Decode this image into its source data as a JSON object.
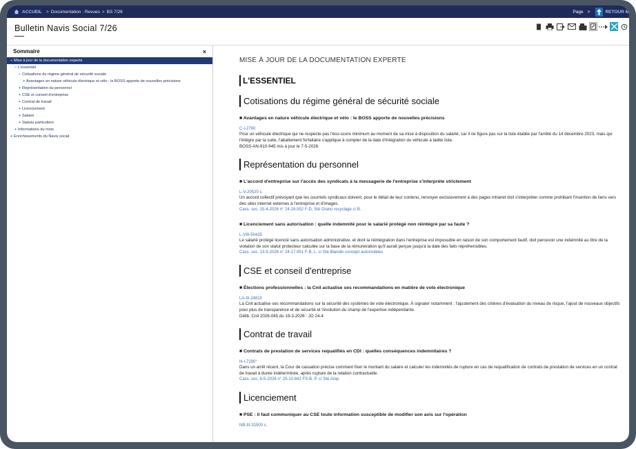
{
  "topbar": {
    "home": "ACCUEIL",
    "crumbs": [
      "Documentation : Revues",
      "BS 7/26"
    ],
    "page_label": "Page",
    "page_arrow": ">",
    "retour_label": "RETOUR M"
  },
  "title": "Bulletin Navis Social 7/26",
  "sidebar": {
    "header": "Sommaire",
    "close": "×",
    "tree": [
      {
        "label": "Mise à jour de la documentation experte",
        "sign": "−",
        "indent": 0,
        "selected": true
      },
      {
        "label": "L'essentiel",
        "sign": "−",
        "indent": 1,
        "selected": false
      },
      {
        "label": "Cotisations du régime général de sécurité sociale",
        "sign": "−",
        "indent": 2,
        "selected": false
      },
      {
        "label": "Avantages en nature véhicule électrique et vélo : le BOSS apporte de nouvelles précisions",
        "sign": ">",
        "indent": 3,
        "selected": false
      },
      {
        "label": "Représentation du personnel",
        "sign": "+",
        "indent": 2,
        "selected": false
      },
      {
        "label": "CSE et conseil d'entreprise",
        "sign": "+",
        "indent": 2,
        "selected": false
      },
      {
        "label": "Contrat de travail",
        "sign": "+",
        "indent": 2,
        "selected": false
      },
      {
        "label": "Licenciement",
        "sign": "+",
        "indent": 2,
        "selected": false
      },
      {
        "label": "Salaire",
        "sign": "+",
        "indent": 2,
        "selected": false
      },
      {
        "label": "Statuts particuliers",
        "sign": "+",
        "indent": 2,
        "selected": false
      },
      {
        "label": "Informations du mois",
        "sign": "+",
        "indent": 1,
        "selected": false
      },
      {
        "label": "Enrichissements du Navis social",
        "sign": "+",
        "indent": 0,
        "selected": false
      }
    ]
  },
  "main": {
    "section_heading": "MISE À JOUR DE LA DOCUMENTATION EXPERTE",
    "essentiel": "L'ESSENTIEL",
    "categories": [
      {
        "title": "Cotisations du régime général de sécurité sociale",
        "articles": [
          {
            "title": "■ Avantages en nature véhicule électrique et vélo : le BOSS apporte de nouvelles précisions",
            "ref": "C-I-2790",
            "body": "Pour un véhicule électrique qui ne respecte pas l'éco-score minimum au moment de sa mise à disposition du salarié, car il ne figure pas sur la liste établie par l'arrêté du 14 décembre 2023, mais qui l'intègre par la suite, l'abattement forfaitaire s'applique à compter de la date d'intégration du véhicule à ladite liste.",
            "source": "",
            "note": "BOSS-AN-910-945 mis à jour le 7-5-2026"
          }
        ]
      },
      {
        "title": "Représentation du personnel",
        "articles": [
          {
            "title": "■ L'accord d'entreprise sur l'accès des syndicats à la messagerie de l'entreprise s'interprète strictement",
            "ref": "L-V-20520 s.",
            "body": "Un accord collectif prévoyant que les courriels syndicaux doivent, pour le détail de leur contenu, renvoyer exclusivement à des pages intranet doit s'interpréter comme prohibant l'insertion de liens vers des sites internet externes à l'entreprise et d'images.",
            "source": "Cass. soc. 15-4-2026 n° 24-18.552 F-D, Sté Orano recyclage c/ B.",
            "note": ""
          },
          {
            "title": "■ Licenciement sans autorisation : quelle indemnité pour le salarié protégé non réintégré par sa faute ?",
            "ref": "L-VIII-50425",
            "body": "Le salarié protégé licencié sans autorisation administrative, et dont la réintégration dans l'entreprise est impossible en raison de son comportement fautif, doit percevoir une indemnité au titre de la violation de son statut protecteur calculée sur la base de la rémunération qu'il aurait perçue jusqu'à la date des faits répréhensibles.",
            "source": "Cass. soc. 13-5-2026 n° 24-17.951 F-B, L. c/ Sté Blandin concept automobiles",
            "note": ""
          }
        ]
      },
      {
        "title": "CSE et conseil d'entreprise",
        "articles": [
          {
            "title": "■ Élections professionnelles : la Cnil actualise ses recommandations en matière de vote électronique",
            "ref": "LA-III-24810",
            "body": "La Cnil actualise ses recommandations sur la sécurité des systèmes de vote électronique. À signaler notamment : l'ajustement des critères d'évaluation du niveau de risque, l'ajout de nouveaux objectifs pour plus de transparence et de sécurité et l'évolution du champ de l'expertise indépendante.",
            "source": "",
            "note": "Délib. Cnil 2026-045 du 19-3-2026 : JO 24-4"
          }
        ]
      },
      {
        "title": "Contrat de travail",
        "articles": [
          {
            "title": "■ Contrats de prestation de services requalifiés en CDI : quelles conséquences indemnitaires ?",
            "ref": "N-I-7290°",
            "body": "Dans un arrêt récent, la Cour de cassation précise comment fixer le montant du salaire et calculer les indemnités de rupture en cas de requalification de contrats de prestation de services en un contrat de travail à durée indéterminée, après rupture de la relation contractuelle.",
            "source": "Cass. soc. 6-5-2026 n° 25-10.842 FS-B, P. c/ Sté Arep",
            "note": ""
          }
        ]
      },
      {
        "title": "Licenciement",
        "articles": [
          {
            "title": "■ PSE : il faut communiquer au CSE toute information susceptible de modifier son avis sur l'opération",
            "ref": "NB-III-31500 s.",
            "body": "",
            "source": "",
            "note": ""
          }
        ]
      }
    ]
  }
}
